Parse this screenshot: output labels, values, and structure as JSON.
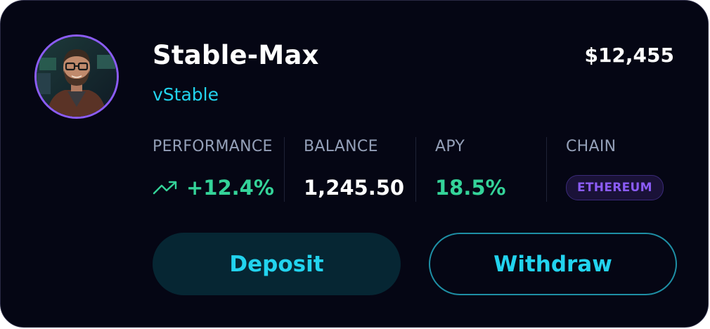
{
  "card": {
    "name": "Stable-Max",
    "subtitle": "vStable",
    "total_value": "$12,455",
    "accent_color": "#22d3ee",
    "avatar_border_color": "#8b5cf6"
  },
  "stats": {
    "performance": {
      "label": "PERFORMANCE",
      "value": "+12.4%",
      "icon": "trending-up-icon",
      "color": "#34d399"
    },
    "balance": {
      "label": "BALANCE",
      "value": "1,245.50",
      "color": "#ffffff"
    },
    "apy": {
      "label": "APY",
      "value": "18.5%",
      "color": "#34d399"
    },
    "chain": {
      "label": "CHAIN",
      "value": "ETHEREUM",
      "color": "#8b5cf6"
    }
  },
  "actions": {
    "deposit_label": "Deposit",
    "withdraw_label": "Withdraw"
  }
}
